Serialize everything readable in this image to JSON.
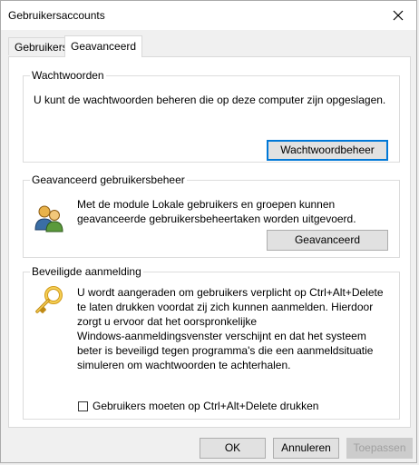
{
  "window": {
    "title": "Gebruikersaccounts"
  },
  "tabs": [
    {
      "label": "Gebruikers"
    },
    {
      "label": "Geavanceerd"
    }
  ],
  "passwords": {
    "legend": "Wachtwoorden",
    "description": "U kunt de wachtwoorden beheren die op deze computer zijn opgeslagen.",
    "button": "Wachtwoordbeheer"
  },
  "advanced_management": {
    "legend": "Geavanceerd gebruikersbeheer",
    "description_lines": [
      "Met de module Lokale gebruikers en groepen kunnen",
      "geavanceerde gebruikersbeheertaken worden uitgevoerd."
    ],
    "button": "Geavanceerd"
  },
  "secure_logon": {
    "legend": "Beveiligde aanmelding",
    "description_lines": [
      "U wordt aangeraden om gebruikers verplicht op Ctrl+Alt+Delete",
      "te laten drukken voordat zij zich kunnen aanmelden. Hierdoor",
      "zorgt u ervoor dat het oorspronkelijke",
      "Windows-aanmeldingsvenster verschijnt en dat het systeem",
      "beter is beveiligd tegen programma's die een aanmeldsituatie",
      "simuleren om wachtwoorden te achterhalen."
    ],
    "checkbox_label": "Gebruikers moeten op Ctrl+Alt+Delete drukken",
    "checkbox_checked": false
  },
  "footer": {
    "ok": "OK",
    "cancel": "Annuleren",
    "apply": "Toepassen"
  }
}
